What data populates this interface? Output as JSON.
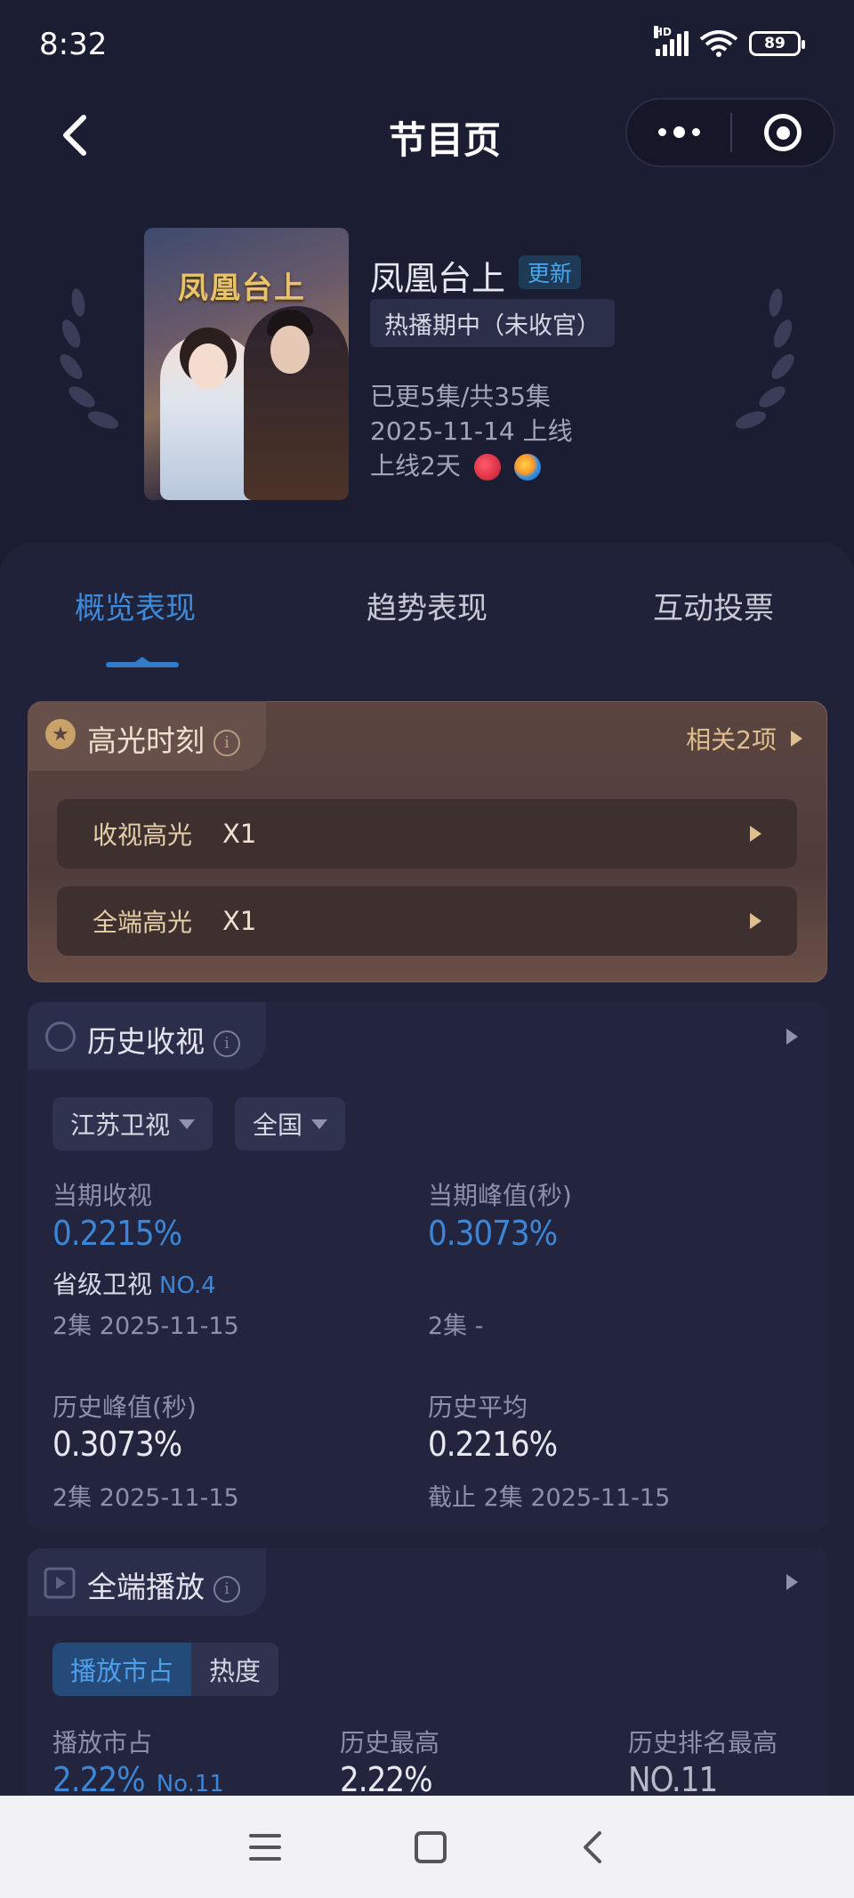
{
  "status_bar": {
    "time": "8:32",
    "network": "HD",
    "battery": "89"
  },
  "nav": {
    "title": "节目页"
  },
  "show": {
    "poster_title": "凤凰台上",
    "title": "凤凰台上",
    "update_badge": "更新",
    "status": "热播期中（未收官）",
    "episodes": "已更5集/共35集",
    "premiere": "2025-11-14 上线",
    "days_online": "上线2天"
  },
  "tabs": [
    {
      "label": "概览表现",
      "active": true
    },
    {
      "label": "趋势表现",
      "active": false
    },
    {
      "label": "互动投票",
      "active": false
    }
  ],
  "highlights": {
    "title": "高光时刻",
    "related": "相关2项",
    "rows": [
      {
        "label": "收视高光",
        "count": "X1"
      },
      {
        "label": "全端高光",
        "count": "X1"
      }
    ]
  },
  "history_ratings": {
    "title": "历史收视",
    "filters": {
      "channel": "江苏卫视",
      "region": "全国"
    },
    "current": {
      "label": "当期收视",
      "value": "0.2215%",
      "rank_label": "省级卫视",
      "rank": "NO.4",
      "sub": "2集 2025-11-15"
    },
    "current_peak": {
      "label": "当期峰值(秒)",
      "value": "0.3073%",
      "sub": "2集 -"
    },
    "history_peak": {
      "label": "历史峰值(秒)",
      "value": "0.3073%",
      "sub": "2集 2025-11-15"
    },
    "history_avg": {
      "label": "历史平均",
      "value": "0.2216%",
      "sub": "截止 2集 2025-11-15"
    }
  },
  "all_platform": {
    "title": "全端播放",
    "segments": [
      "播放市占",
      "热度"
    ],
    "share": {
      "label": "播放市占",
      "value": "2.22%",
      "rank": "No.11"
    },
    "hist_high": {
      "label": "历史最高",
      "value": "2.22%"
    },
    "hist_rank_high": {
      "label": "历史排名最高",
      "value": "NO.11"
    }
  }
}
